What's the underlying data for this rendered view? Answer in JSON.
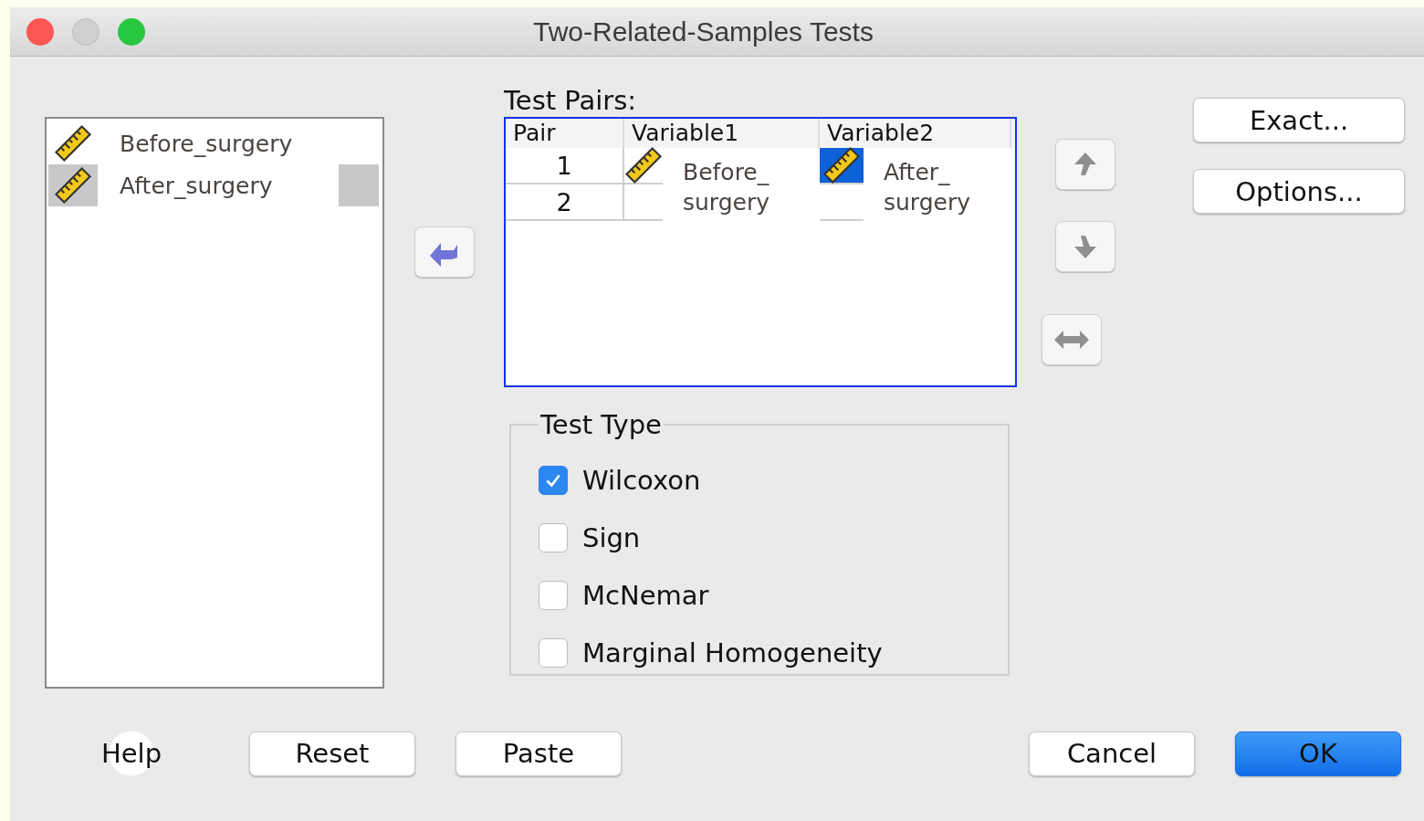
{
  "window": {
    "title": "Two-Related-Samples Tests"
  },
  "variables": [
    {
      "name": "Before_surgery",
      "selected": false
    },
    {
      "name": "After_surgery",
      "selected": true
    }
  ],
  "test_pairs": {
    "label": "Test Pairs:",
    "columns": [
      "Pair",
      "Variable1",
      "Variable2"
    ],
    "rows": [
      {
        "pair": "1",
        "variable1": "Before_ surgery",
        "variable1_selected": false,
        "variable2": "After_ surgery",
        "variable2_selected": true
      },
      {
        "pair": "2"
      }
    ]
  },
  "side_buttons": [
    "Exact...",
    "Options..."
  ],
  "test_type": {
    "label": "Test Type",
    "options": [
      {
        "label": "Wilcoxon",
        "checked": true
      },
      {
        "label": "Sign",
        "checked": false
      },
      {
        "label": "McNemar",
        "checked": false
      },
      {
        "label": "Marginal Homogeneity",
        "checked": false
      }
    ]
  },
  "footer": {
    "help": "Help",
    "buttons": [
      {
        "label": "Reset",
        "default": false
      },
      {
        "label": "Paste",
        "default": false
      },
      {
        "label": "Cancel",
        "default": false
      },
      {
        "label": "OK",
        "default": true
      }
    ]
  }
}
